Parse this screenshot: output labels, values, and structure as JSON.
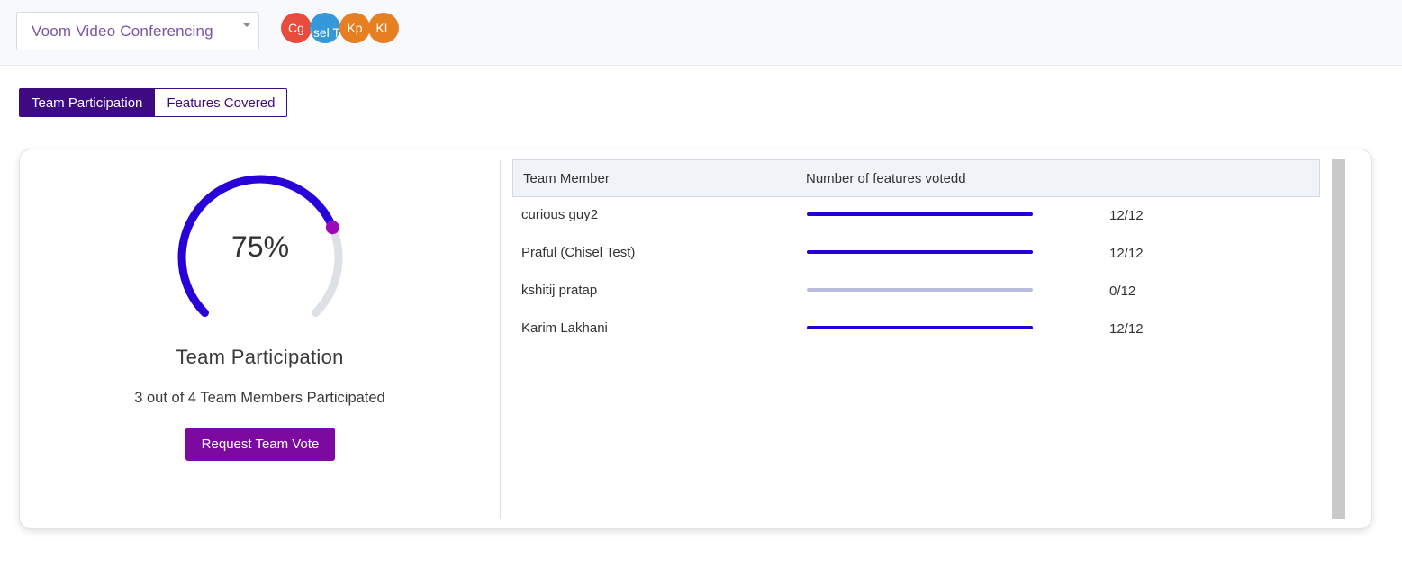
{
  "header": {
    "project_selector": {
      "value": "Voom Video Conferencing"
    },
    "avatars": [
      {
        "initials": "Cg",
        "color": "#e74c3c"
      },
      {
        "initials": "Chisel Test",
        "color": "#3498db"
      },
      {
        "initials": "Kp",
        "color": "#e67e22"
      },
      {
        "initials": "KL",
        "color": "#e67e22"
      }
    ]
  },
  "tabs": [
    {
      "label": "Team Participation",
      "active": true
    },
    {
      "label": "Features Covered",
      "active": false
    }
  ],
  "participation": {
    "gauge_value": "75%",
    "gauge_percent": 75,
    "title": "Team Participation",
    "subtitle": "3 out of 4 Team Members Participated",
    "button_label": "Request Team Vote"
  },
  "table": {
    "headers": {
      "member": "Team Member",
      "features": "Number of features votedd"
    },
    "rows": [
      {
        "name": "curious guy2",
        "voted": 12,
        "total": 12,
        "count": "12/12"
      },
      {
        "name": "Praful (Chisel Test)",
        "voted": 12,
        "total": 12,
        "count": "12/12"
      },
      {
        "name": "kshitij pratap",
        "voted": 0,
        "total": 12,
        "count": "0/12"
      },
      {
        "name": "Karim Lakhani",
        "voted": 12,
        "total": 12,
        "count": "12/12"
      }
    ]
  },
  "colors": {
    "primary": "#3e0a82",
    "button": "#7c0aa0",
    "bar_fill": "#2300d6",
    "bar_track": "#b8bbdb",
    "gauge_start": "#2a00d8",
    "gauge_end": "#9b0ab6",
    "gauge_track": "#dde1e6"
  }
}
